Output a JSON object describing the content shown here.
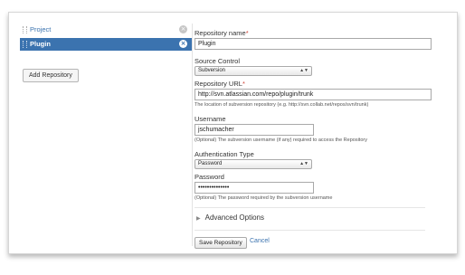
{
  "sidebar": {
    "items": [
      {
        "label": "Project",
        "selected": false
      },
      {
        "label": "Plugin",
        "selected": true
      }
    ],
    "add_button": "Add Repository",
    "remove_icon": "close-icon",
    "drag_icon": "drag-handle-icon"
  },
  "form": {
    "repo_name": {
      "label": "Repository name",
      "required": "*",
      "value": "Plugin"
    },
    "source_control": {
      "label": "Source Control",
      "value": "Subversion"
    },
    "repo_url": {
      "label": "Repository URL",
      "required": "*",
      "value": "http://svn.atlassian.com/repo/plugin/trunk",
      "hint": "The location of subversion repository (e.g. http://svn.collab.net/repos/svn/trunk)"
    },
    "username": {
      "label": "Username",
      "value": "jschumacher",
      "hint": "(Optional) The subversion username (if any) required to access the Repository"
    },
    "auth_type": {
      "label": "Authentication Type",
      "value": "Password"
    },
    "password": {
      "label": "Password",
      "value": "••••••••••••••",
      "hint": "(Optional) The password required by the subversion username"
    },
    "advanced": {
      "label": "Advanced Options"
    },
    "actions": {
      "save": "Save Repository",
      "cancel": "Cancel"
    }
  },
  "colors": {
    "accent": "#3b73af",
    "required": "#d04437"
  }
}
